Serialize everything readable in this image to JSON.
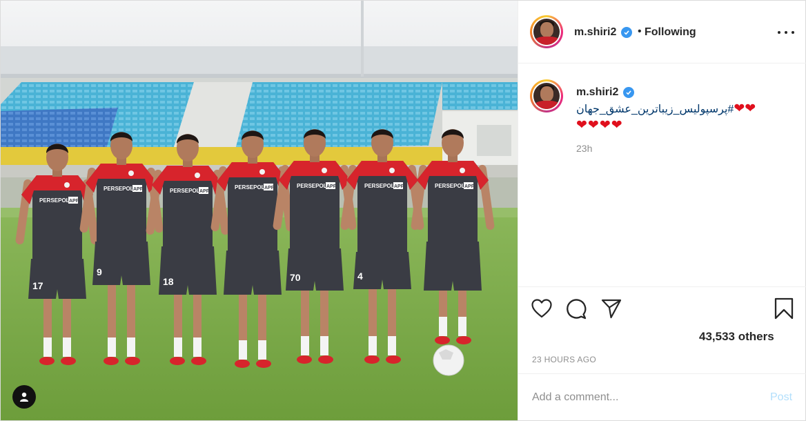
{
  "post": {
    "author": {
      "username": "m.shiri2",
      "verified": true,
      "avatar_icon": "profile-avatar"
    },
    "header": {
      "separator": "•",
      "follow_label": "Following",
      "more_icon": "more-options-icon"
    },
    "caption": {
      "username": "m.shiri2",
      "line1": "#پرسپولیس_زیباترین_عشق_جهان",
      "hearts_line1": "❤❤",
      "hearts_line2": "❤❤❤❤",
      "time": "23h"
    },
    "actions": {
      "like_icon": "heart-outline-icon",
      "comment_icon": "comment-bubble-icon",
      "share_icon": "paper-plane-icon",
      "save_icon": "bookmark-icon"
    },
    "likes_text": "43,533 others",
    "timestamp": "23 HOURS AGO",
    "comment_box": {
      "placeholder": "Add a comment...",
      "post_label": "Post"
    }
  },
  "media": {
    "jersey_brand": "PERSEPOLIS",
    "jersey_sponsor": "APP",
    "players": [
      {
        "number": "17"
      },
      {
        "number": "9"
      },
      {
        "number": "18"
      },
      {
        "number": ""
      },
      {
        "number": "70"
      },
      {
        "number": "4"
      },
      {
        "number": ""
      }
    ],
    "tag_icon": "user-tag-icon"
  },
  "colors": {
    "link": "#00376b",
    "verified": "#3897f0",
    "muted": "#8e8e8e",
    "post_disabled": "#b2dffc",
    "jersey_red": "#d7242c",
    "jersey_dark": "#3a3c44"
  }
}
